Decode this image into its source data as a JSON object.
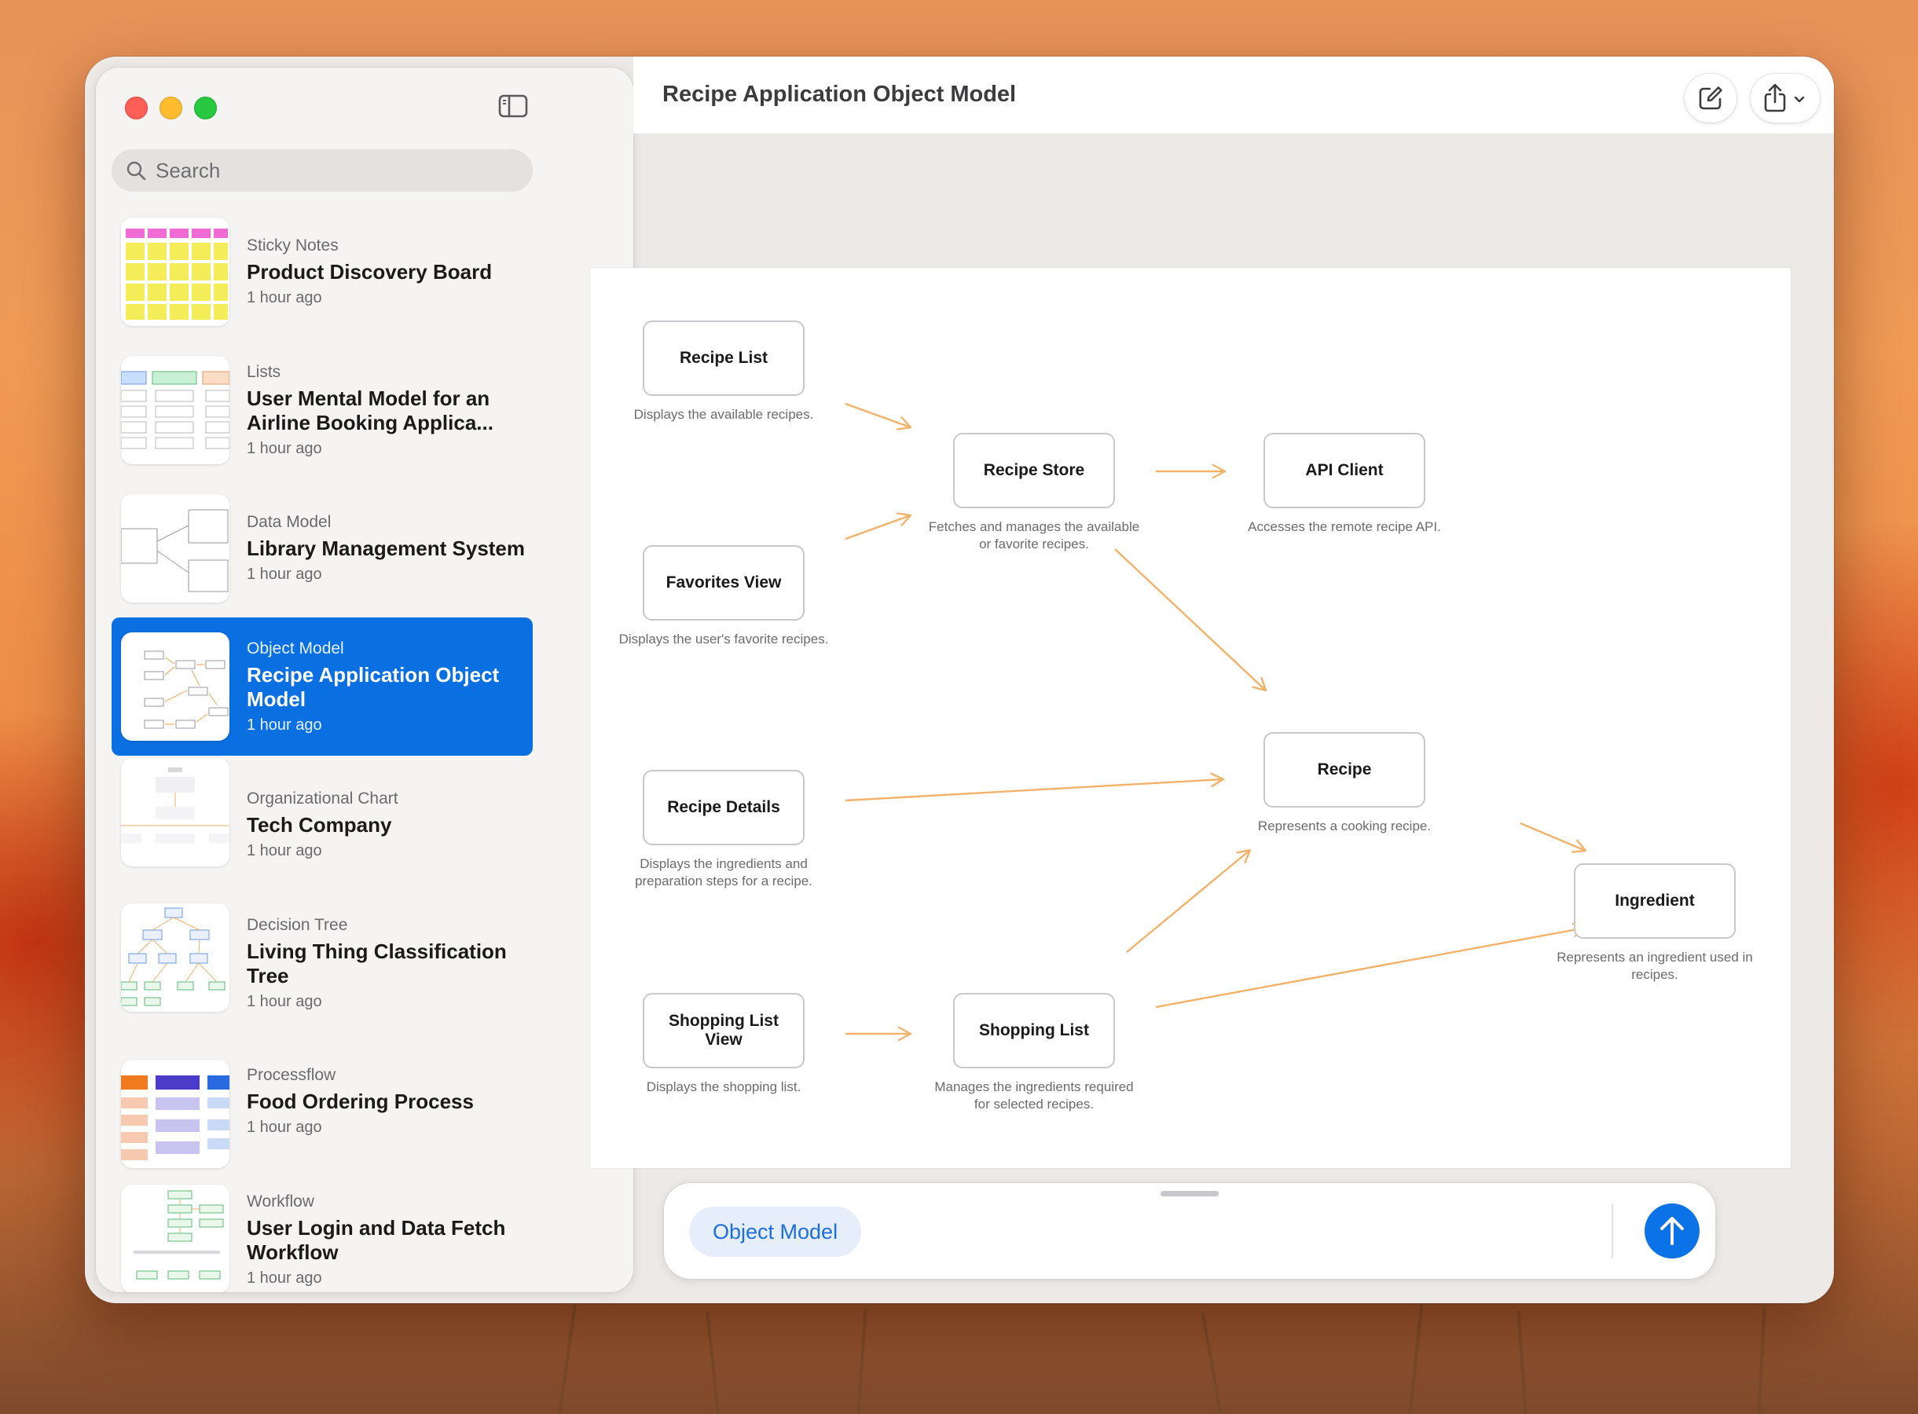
{
  "window_title": "Recipe Application Object Model",
  "search": {
    "placeholder": "Search"
  },
  "documents": [
    {
      "category": "Sticky Notes",
      "title": "Product Discovery Board",
      "time": "1 hour ago"
    },
    {
      "category": "Lists",
      "title": "User Mental Model for an Airline Booking Applica...",
      "time": "1 hour ago"
    },
    {
      "category": "Data Model",
      "title": "Library Management System",
      "time": "1 hour ago"
    },
    {
      "category": "Object Model",
      "title": "Recipe Application Object Model",
      "time": "1 hour ago"
    },
    {
      "category": "Organizational Chart",
      "title": "Tech Company",
      "time": "1 hour ago"
    },
    {
      "category": "Decision Tree",
      "title": "Living Thing Classification Tree",
      "time": "1 hour ago"
    },
    {
      "category": "Processflow",
      "title": "Food Ordering Process",
      "time": "1 hour ago"
    },
    {
      "category": "Workflow",
      "title": "User Login and Data Fetch Workflow",
      "time": "1 hour ago"
    }
  ],
  "diagram": {
    "nodes": [
      {
        "label": "Recipe List",
        "desc": "Displays the available recipes."
      },
      {
        "label": "Recipe Store",
        "desc": "Fetches and manages the available or favorite recipes."
      },
      {
        "label": "API Client",
        "desc": "Accesses the remote recipe API."
      },
      {
        "label": "Favorites View",
        "desc": "Displays the user's favorite recipes."
      },
      {
        "label": "Recipe",
        "desc": "Represents a cooking recipe."
      },
      {
        "label": "Recipe Details",
        "desc": "Displays the ingredients and preparation steps for a recipe."
      },
      {
        "label": "Ingredient",
        "desc": "Represents an ingredient used in recipes."
      },
      {
        "label": "Shopping List View",
        "desc": "Displays the shopping list."
      },
      {
        "label": "Shopping List",
        "desc": "Manages the ingredients required for selected recipes."
      }
    ]
  },
  "prompt": {
    "chip": "Object Model"
  },
  "colors": {
    "accent": "#0a6fe0",
    "arrow": "#f2b26a"
  }
}
